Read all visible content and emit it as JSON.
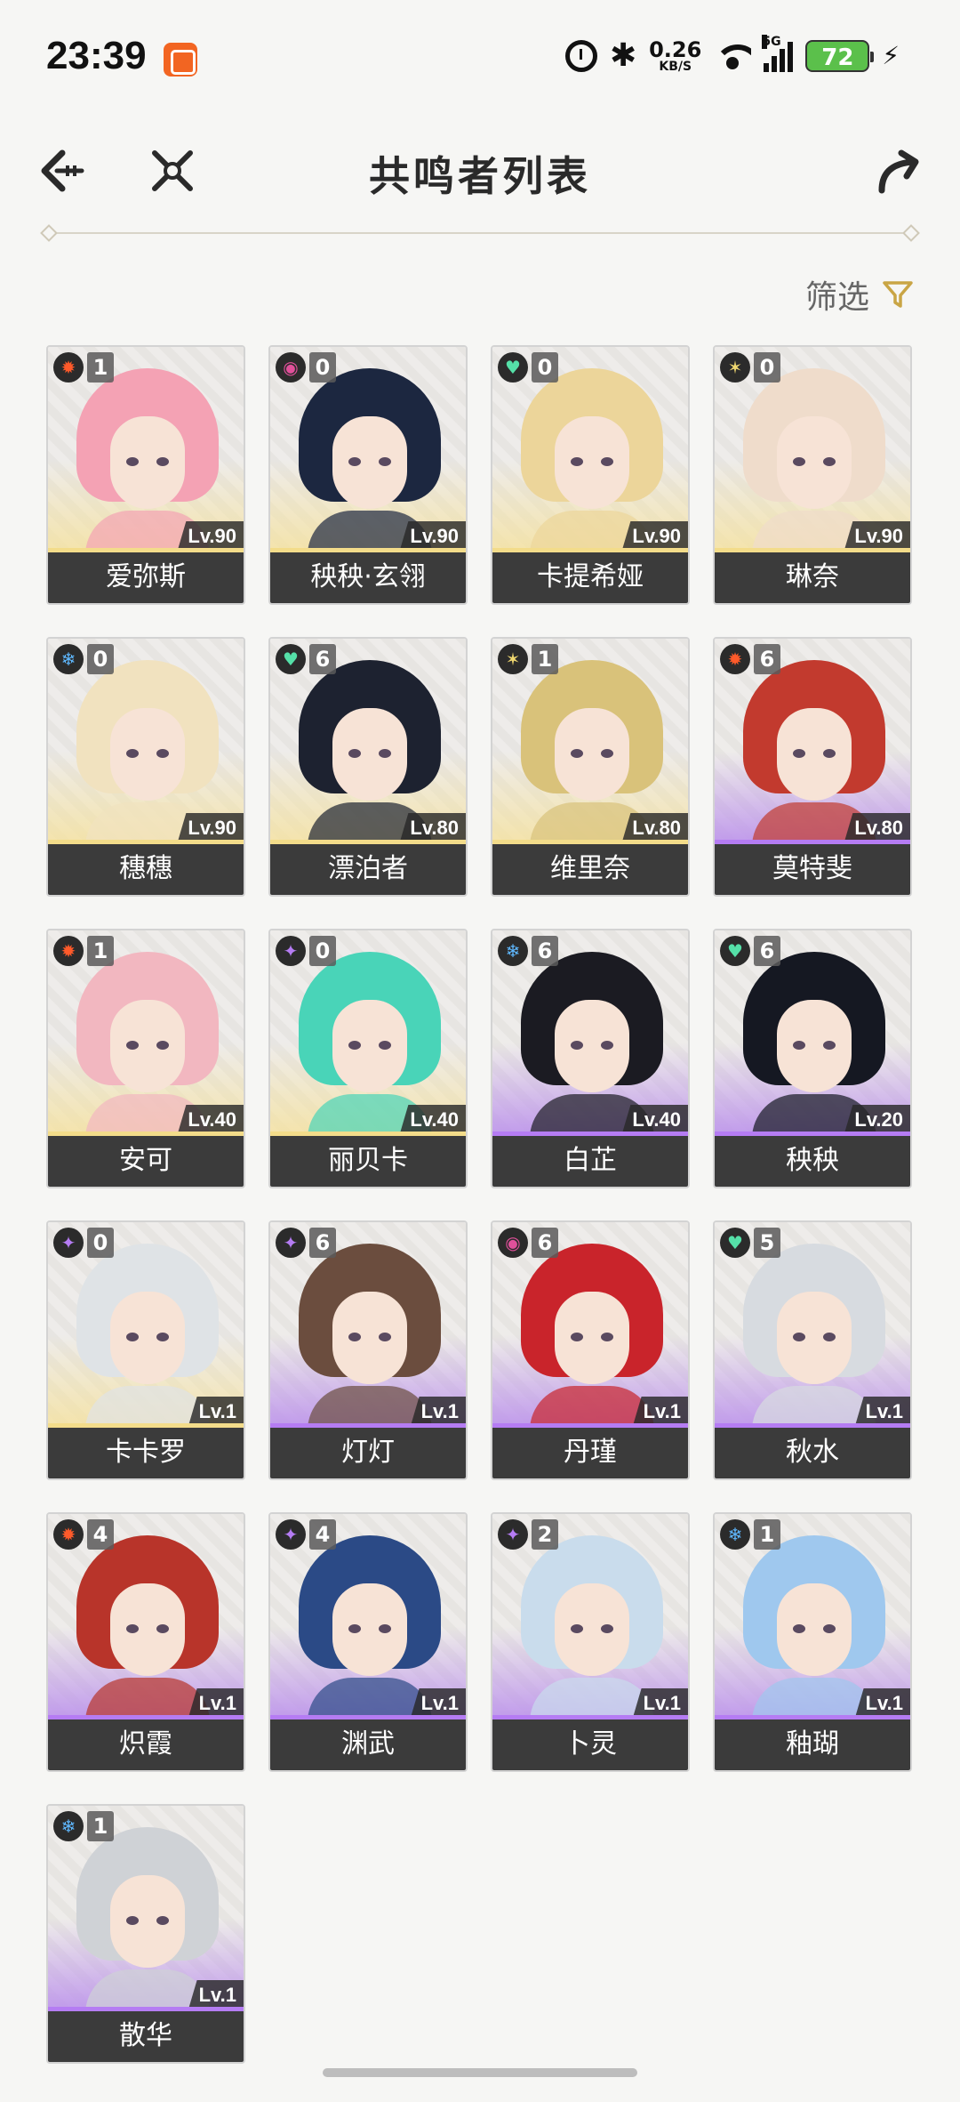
{
  "status_bar": {
    "time": "23:39",
    "net_speed": "0.26",
    "net_unit": "KB/S",
    "network": "5G",
    "battery": "72"
  },
  "header": {
    "title": "共鸣者列表"
  },
  "filter": {
    "label": "筛选"
  },
  "element_colors": {
    "fusion": "#ff5a2a",
    "electro": "#b57cf3",
    "havoc": "#e0509a",
    "aero": "#55e0a8",
    "spectro": "#f0d870",
    "glacio": "#5fb8ff"
  },
  "characters": [
    {
      "name": "爱弥斯",
      "rank": "1",
      "level": "Lv.90",
      "element": "fusion",
      "hair": "#f4a2b4",
      "tier": "gold"
    },
    {
      "name": "秧秧·玄翎",
      "rank": "0",
      "level": "Lv.90",
      "element": "havoc",
      "hair": "#1c2740",
      "tier": "gold"
    },
    {
      "name": "卡提希娅",
      "rank": "0",
      "level": "Lv.90",
      "element": "aero",
      "hair": "#ecd59a",
      "tier": "gold"
    },
    {
      "name": "琳奈",
      "rank": "0",
      "level": "Lv.90",
      "element": "spectro",
      "hair": "#efdccb",
      "tier": "gold"
    },
    {
      "name": "穗穗",
      "rank": "0",
      "level": "Lv.90",
      "element": "glacio",
      "hair": "#f1e2bf",
      "tier": "gold"
    },
    {
      "name": "漂泊者",
      "rank": "6",
      "level": "Lv.80",
      "element": "aero",
      "hair": "#1d2230",
      "tier": "gold"
    },
    {
      "name": "维里奈",
      "rank": "1",
      "level": "Lv.80",
      "element": "spectro",
      "hair": "#d9c27a",
      "tier": "gold"
    },
    {
      "name": "莫特斐",
      "rank": "6",
      "level": "Lv.80",
      "element": "fusion",
      "hair": "#c23a2e",
      "tier": "purple"
    },
    {
      "name": "安可",
      "rank": "1",
      "level": "Lv.40",
      "element": "fusion",
      "hair": "#f2b7c0",
      "tier": "gold"
    },
    {
      "name": "丽贝卡",
      "rank": "0",
      "level": "Lv.40",
      "element": "electro",
      "hair": "#49d4b8",
      "tier": "gold"
    },
    {
      "name": "白芷",
      "rank": "6",
      "level": "Lv.40",
      "element": "glacio",
      "hair": "#1b1b22",
      "tier": "purple"
    },
    {
      "name": "秧秧",
      "rank": "6",
      "level": "Lv.20",
      "element": "aero",
      "hair": "#151822",
      "tier": "purple"
    },
    {
      "name": "卡卡罗",
      "rank": "0",
      "level": "Lv.1",
      "element": "electro",
      "hair": "#dfe3e6",
      "tier": "gold"
    },
    {
      "name": "灯灯",
      "rank": "6",
      "level": "Lv.1",
      "element": "electro",
      "hair": "#6b4d3e",
      "tier": "purple"
    },
    {
      "name": "丹瑾",
      "rank": "6",
      "level": "Lv.1",
      "element": "havoc",
      "hair": "#c9242b",
      "tier": "purple"
    },
    {
      "name": "秋水",
      "rank": "5",
      "level": "Lv.1",
      "element": "aero",
      "hair": "#d7dbe0",
      "tier": "purple"
    },
    {
      "name": "炽霞",
      "rank": "4",
      "level": "Lv.1",
      "element": "fusion",
      "hair": "#b8342a",
      "tier": "purple"
    },
    {
      "name": "渊武",
      "rank": "4",
      "level": "Lv.1",
      "element": "electro",
      "hair": "#2b4a86",
      "tier": "purple"
    },
    {
      "name": "卜灵",
      "rank": "2",
      "level": "Lv.1",
      "element": "electro",
      "hair": "#c9dcec",
      "tier": "purple"
    },
    {
      "name": "釉瑚",
      "rank": "1",
      "level": "Lv.1",
      "element": "glacio",
      "hair": "#9fc8ee",
      "tier": "purple"
    },
    {
      "name": "散华",
      "rank": "1",
      "level": "Lv.1",
      "element": "glacio",
      "hair": "#cfd2d6",
      "tier": "purple"
    }
  ]
}
